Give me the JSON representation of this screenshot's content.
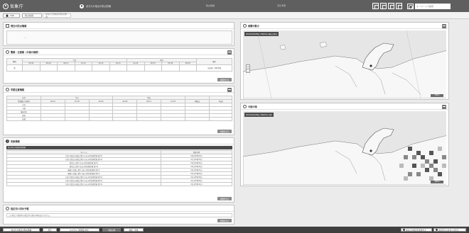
{
  "header": {
    "logo": "気象庁",
    "status_text": "あなたの地点の防災情報",
    "center_a": "防災情報",
    "center_b": "天気予報",
    "search_placeholder": "キーワードで検索"
  },
  "tabs": [
    {
      "label": "TOP"
    },
    {
      "label": "防災情報"
    },
    {
      "label": "あなたの地点の防災情報"
    }
  ],
  "panels": {
    "p1": {
      "title": "現在の防災情報",
      "placeholder": "ー"
    },
    "p2": {
      "title": "警報・注意報（今後の推移）",
      "head_row1": [
        "",
        "",
        "",
        "今日",
        "",
        "",
        "",
        "明日",
        "",
        "",
        "備考"
      ],
      "head_row2": [
        "種別",
        "03-06",
        "06-09",
        "09-12",
        "12-15",
        "15-18",
        "18-21",
        "21-24",
        "00-03",
        "03-06",
        "06-09",
        "発表する警報等"
      ],
      "row": [
        "雷",
        "",
        "",
        "",
        "",
        "",
        "",
        "",
        "",
        "",
        "",
        "注意報・特別警報"
      ],
      "note": "詳細を見る",
      "more": "詳細を見る"
    },
    "p3": {
      "title": "早期注意情報",
      "head": [
        "日付",
        "",
        "今日",
        "",
        "",
        "明日",
        "",
        "",
        "",
        ""
      ],
      "head2": [
        "警報級の可能性",
        "06-12",
        "12-18",
        "18-24",
        "00-06",
        "06-12",
        "12-18",
        "18-24",
        "明後日",
        "3日後"
      ],
      "rows": [
        [
          "大雨",
          "",
          "",
          "",
          "",
          "",
          "",
          "",
          "",
          ""
        ],
        [
          "大雪",
          "",
          "",
          "",
          "",
          "",
          "",
          "",
          "",
          ""
        ],
        [
          "暴風(雪)",
          "",
          "",
          "",
          "",
          "",
          "",
          "",
          "",
          ""
        ],
        [
          "波浪",
          "",
          "",
          "",
          "",
          "",
          "",
          "",
          "",
          ""
        ],
        [
          "高潮",
          "",
          "",
          "",
          "",
          "",
          "",
          "",
          "",
          ""
        ]
      ],
      "more": "詳細を見る"
    },
    "p4": {
      "title": "気象情報",
      "table_label": "石川県の全般気象情報",
      "col1": "タイトル",
      "col2": "発表日時",
      "rows": [
        [
          "大雨と雷及び突風に関する石川県気象情報 第2号",
          "08日06時00分"
        ],
        [
          "大雨と雷及び突風に関する石川県気象情報 第1号",
          "07日16時33分"
        ],
        [
          "低気圧に関する石川県気象情報 第2号",
          "06日09時44分"
        ],
        [
          "低気圧に関する石川県気象情報 第1号",
          "05日16時42分"
        ],
        [
          "暴風と高波に関する石川県気象情報 第1号",
          "04日05時41分"
        ],
        [
          "暴風と高波に関する石川県気象情報 第1号",
          "03日16時00分"
        ],
        [
          "大雨と雷及び突風に関する石川県気象情報 第3号",
          "02日09時38分"
        ],
        [
          "大雨と雷及び突風に関する石川県気象情報 第2号",
          "01日16時00分"
        ],
        [
          "大雨と雷及び突風に関する石川県気象情報 第1号",
          "01日05時41分"
        ]
      ],
      "more": "詳細を見る"
    },
    "p5": {
      "title": "指定河川洪水予報",
      "text": "この地点で発表中の指定河川洪水予報はありません。",
      "more": "詳細を見る"
    },
    "map1": {
      "title": "雨雲の動き",
      "label": "2022年08月08日 10時00分 現在の状況",
      "scale": "10km"
    },
    "map2": {
      "title": "今後の雨",
      "label": "2022年08月08日 10時00分 予想",
      "scale": "10km"
    }
  },
  "bottom_tabs": [
    {
      "label": "あなたの地点の防災情報"
    },
    {
      "label": "天気"
    },
    {
      "label": "キキクル（危険度分布）"
    },
    {
      "label": "今後の雨"
    },
    {
      "label": "地震・津波"
    }
  ],
  "bottom_buttons": [
    {
      "label": "あなたの地点を変更する"
    },
    {
      "label": "表示をカスタマイズする"
    }
  ],
  "colors": {
    "header_bg": "#5f5f5f",
    "bottom_bg": "#3f3f3f",
    "map_sea": "#e6e6e6",
    "map_land": "#f7f7f7"
  }
}
